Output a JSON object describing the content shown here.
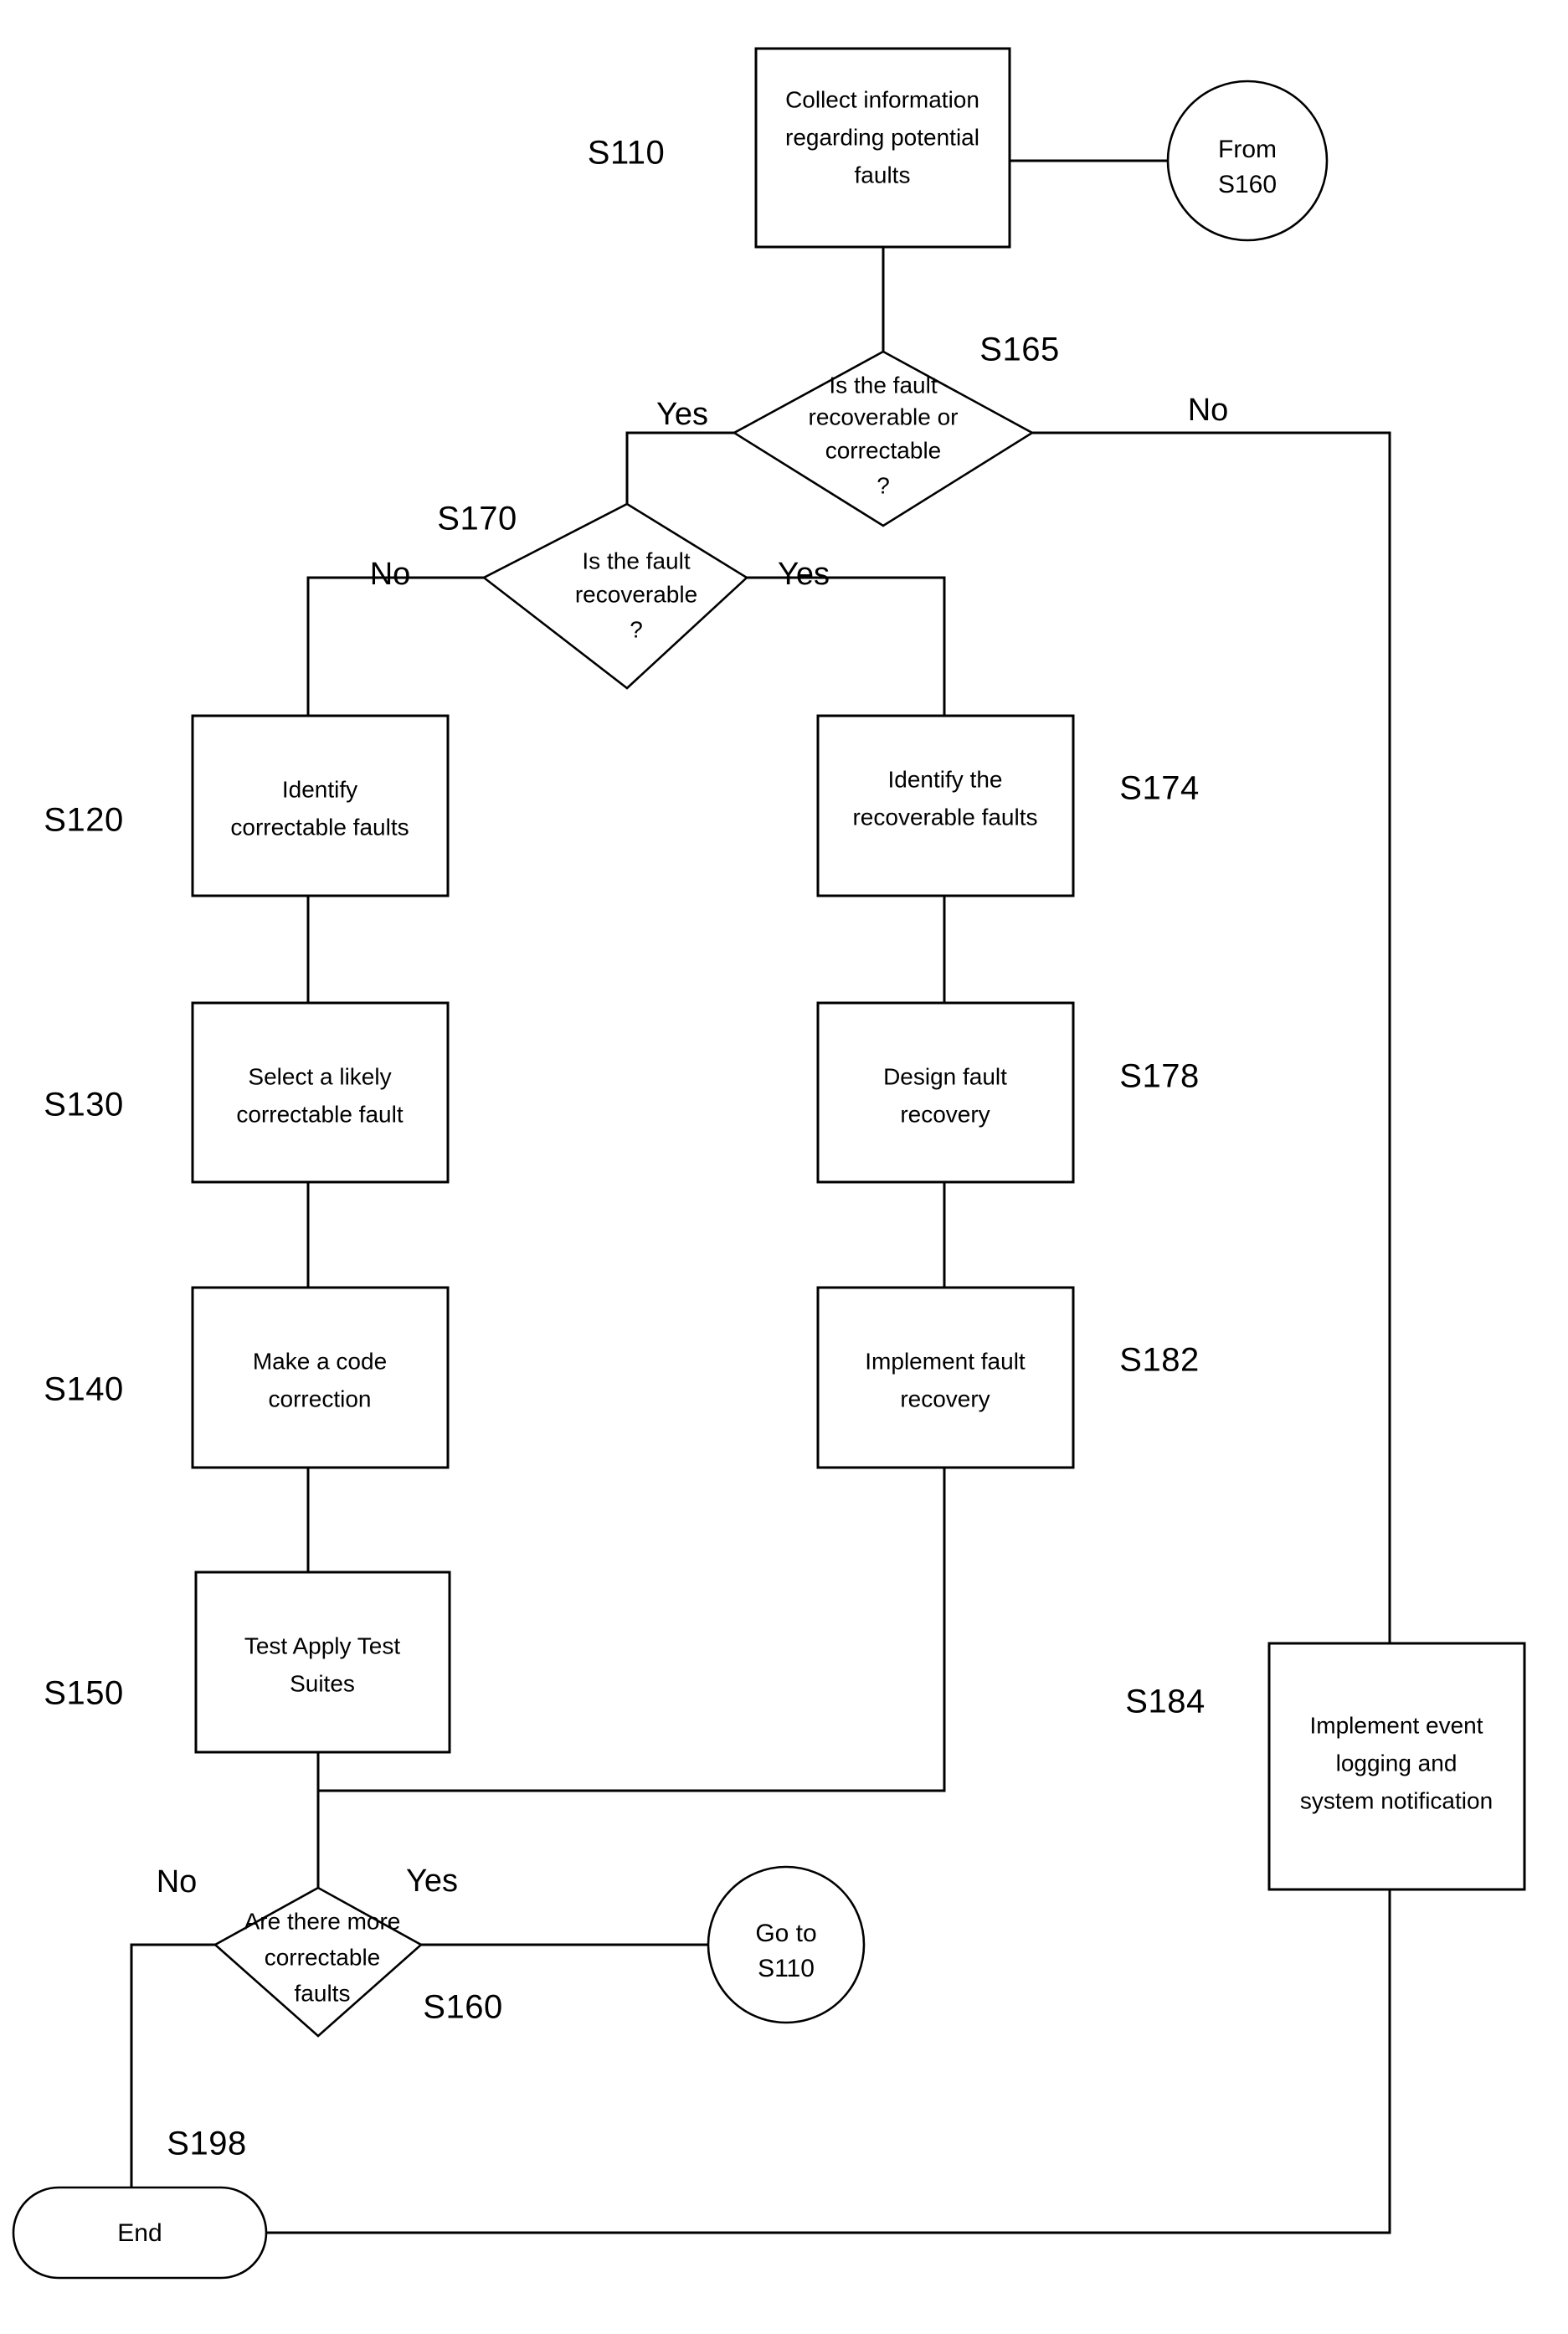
{
  "diagram": {
    "type": "flowchart",
    "title": "Fault correction and recovery process flowchart",
    "stroke_color": "#000000",
    "fill_color": "#ffffff",
    "background": "#ffffff"
  },
  "nodes": {
    "s110": {
      "ref": "S110",
      "shape": "process",
      "lines": [
        "Collect information",
        "regarding potential",
        "faults"
      ]
    },
    "from_s160": {
      "shape": "connector-circle",
      "lines": [
        "From",
        "S160"
      ]
    },
    "s165": {
      "ref": "S165",
      "shape": "decision",
      "lines": [
        "Is the fault",
        "recoverable or",
        "correctable",
        "?"
      ],
      "yes_label": "Yes",
      "no_label": "No"
    },
    "s170": {
      "ref": "S170",
      "shape": "decision",
      "lines": [
        "Is the fault",
        "recoverable",
        "?"
      ],
      "yes_label": "Yes",
      "no_label": "No"
    },
    "s120": {
      "ref": "S120",
      "shape": "process",
      "lines": [
        "Identify",
        "correctable faults"
      ]
    },
    "s130": {
      "ref": "S130",
      "shape": "process",
      "lines": [
        "Select a likely",
        "correctable fault"
      ]
    },
    "s140": {
      "ref": "S140",
      "shape": "process",
      "lines": [
        "Make a code",
        "correction"
      ]
    },
    "s150": {
      "ref": "S150",
      "shape": "process",
      "lines": [
        "Test Apply Test",
        "Suites"
      ]
    },
    "s174": {
      "ref": "S174",
      "shape": "process",
      "lines": [
        "Identify the",
        "recoverable faults"
      ]
    },
    "s178": {
      "ref": "S178",
      "shape": "process",
      "lines": [
        "Design fault",
        "recovery"
      ]
    },
    "s182": {
      "ref": "S182",
      "shape": "process",
      "lines": [
        "Implement fault",
        "recovery"
      ]
    },
    "s184": {
      "ref": "S184",
      "shape": "process",
      "lines": [
        "Implement event",
        "logging and",
        "system notification"
      ]
    },
    "s160": {
      "ref": "S160",
      "shape": "decision",
      "lines": [
        "Are there more",
        "correctable",
        "faults"
      ],
      "yes_label": "Yes",
      "no_label": "No"
    },
    "goto_s110": {
      "shape": "connector-circle",
      "lines": [
        "Go to",
        "S110"
      ]
    },
    "s198": {
      "ref": "S198",
      "shape": "terminator",
      "lines": [
        "End"
      ]
    }
  }
}
